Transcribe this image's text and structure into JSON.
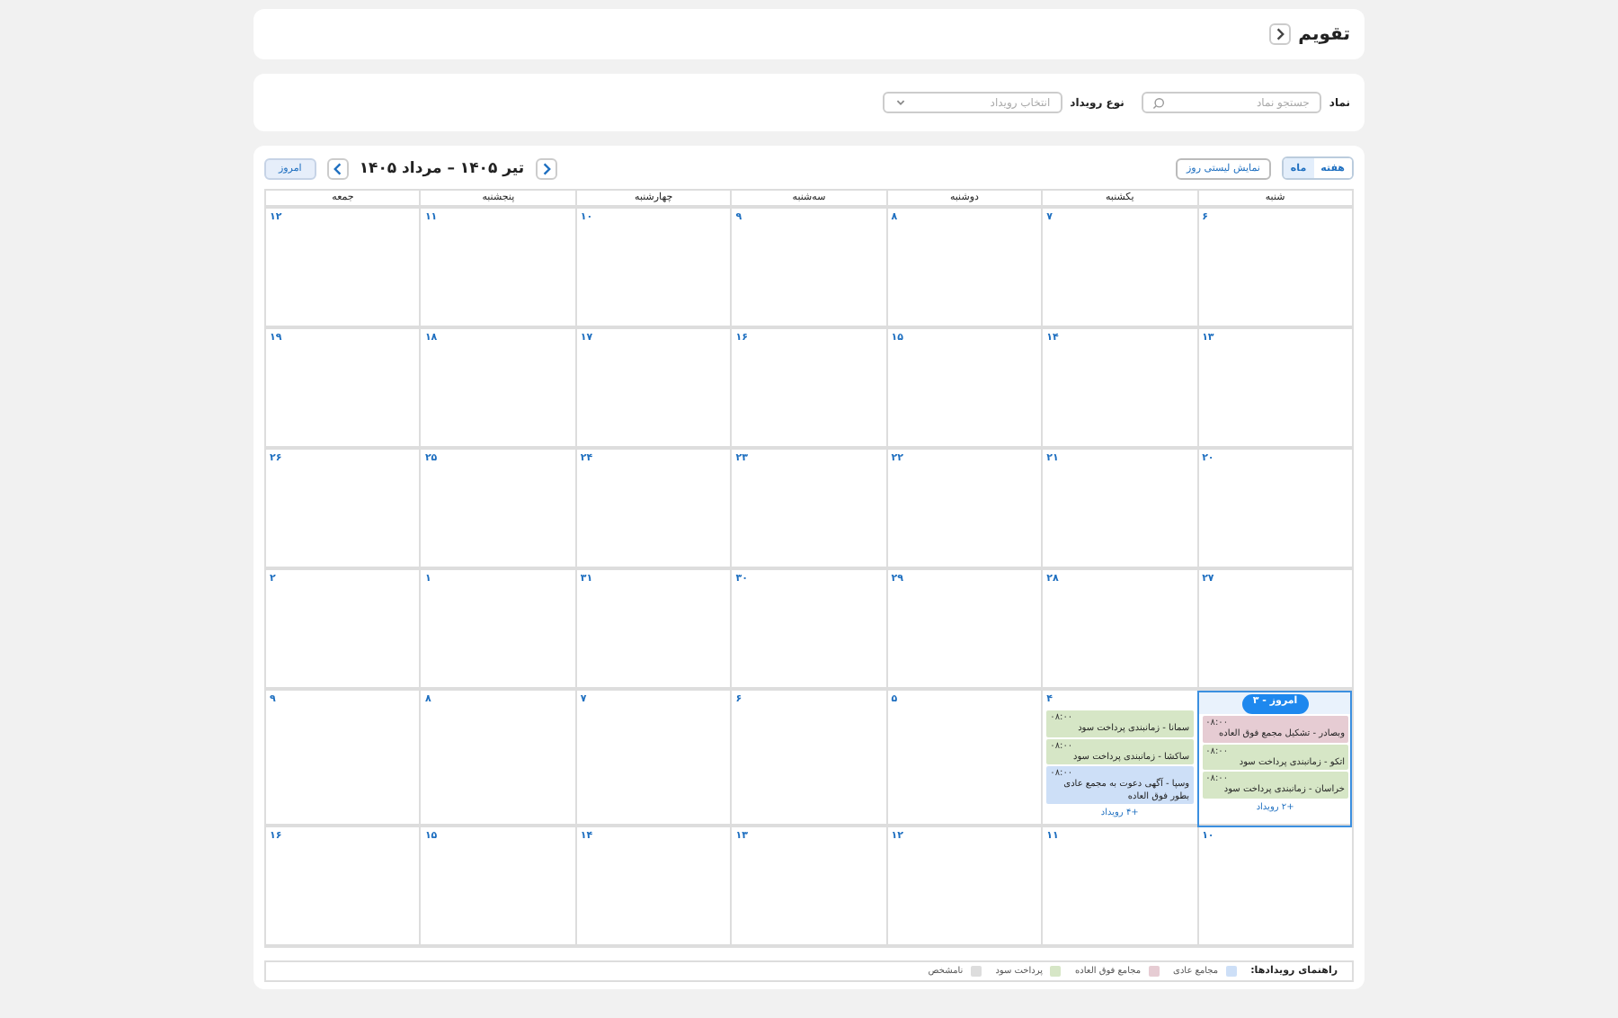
{
  "header": {
    "title": "تقویم"
  },
  "filters": [
    {
      "kind": "search",
      "label": "نماد",
      "placeholder": "جستجو نماد"
    },
    {
      "kind": "select",
      "label": "نوع رویداد",
      "placeholder": "انتخاب رویداد"
    }
  ],
  "view_tabs": [
    {
      "label": "هفته",
      "selected": false
    },
    {
      "label": "ماه",
      "selected": true
    }
  ],
  "list_view_button": "نمایش لیستی روز",
  "range_title": "تیر ۱۴۰۵ – مرداد ۱۴۰۵",
  "today_button": "امروز",
  "weekdays": [
    "شنبه",
    "یکشنبه",
    "دوشنبه",
    "سه‌شنبه",
    "چهارشنبه",
    "پنجشنبه",
    "جمعه"
  ],
  "weeks": [
    [
      {
        "day": "۶",
        "today": false
      },
      {
        "day": "۷",
        "today": false
      },
      {
        "day": "۸",
        "today": false
      },
      {
        "day": "۹",
        "today": false
      },
      {
        "day": "۱۰",
        "today": false
      },
      {
        "day": "۱۱",
        "today": false
      },
      {
        "day": "۱۲",
        "today": false
      }
    ],
    [
      {
        "day": "۱۳",
        "today": false
      },
      {
        "day": "۱۴",
        "today": false
      },
      {
        "day": "۱۵",
        "today": false
      },
      {
        "day": "۱۶",
        "today": false
      },
      {
        "day": "۱۷",
        "today": false
      },
      {
        "day": "۱۸",
        "today": false
      },
      {
        "day": "۱۹",
        "today": false
      }
    ],
    [
      {
        "day": "۲۰",
        "today": false
      },
      {
        "day": "۲۱",
        "today": false
      },
      {
        "day": "۲۲",
        "today": false
      },
      {
        "day": "۲۳",
        "today": false
      },
      {
        "day": "۲۴",
        "today": false
      },
      {
        "day": "۲۵",
        "today": false
      },
      {
        "day": "۲۶",
        "today": false
      }
    ],
    [
      {
        "day": "۲۷",
        "today": false
      },
      {
        "day": "۲۸",
        "today": false
      },
      {
        "day": "۲۹",
        "today": false
      },
      {
        "day": "۳۰",
        "today": false
      },
      {
        "day": "۳۱",
        "today": false
      },
      {
        "day": "۱",
        "today": false
      },
      {
        "day": "۲",
        "today": false
      }
    ],
    [
      {
        "badge": "امروز - ۳",
        "today": true,
        "events": [
          {
            "time": "۰۸:۰۰",
            "title": "وبصادر - تشکیل مجمع فوق العاده",
            "color": "#e6ccd3"
          },
          {
            "time": "۰۸:۰۰",
            "title": "اتکو - زمانبندی پرداخت سود",
            "color": "#d6e6c6"
          },
          {
            "time": "۰۸:۰۰",
            "title": "خراسان - زمانبندی پرداخت سود",
            "color": "#d6e6c6"
          }
        ],
        "more": "+۲ رویداد"
      },
      {
        "day": "۴",
        "today": false,
        "events": [
          {
            "time": "۰۸:۰۰",
            "title": "سمانا - زمانبندی پرداخت سود",
            "color": "#d6e6c6"
          },
          {
            "time": "۰۸:۰۰",
            "title": "ساکشا - زمانبندی پرداخت سود",
            "color": "#d6e6c6"
          },
          {
            "time": "۰۸:۰۰",
            "title": "وسپا - آگهی دعوت به مجمع عادی بطور فوق العاده",
            "color": "#cddff7"
          }
        ],
        "more": "+۴ رویداد"
      },
      {
        "day": "۵",
        "today": false
      },
      {
        "day": "۶",
        "today": false
      },
      {
        "day": "۷",
        "today": false
      },
      {
        "day": "۸",
        "today": false
      },
      {
        "day": "۹",
        "today": false
      }
    ],
    [
      {
        "day": "۱۰",
        "today": false
      },
      {
        "day": "۱۱",
        "today": false
      },
      {
        "day": "۱۲",
        "today": false
      },
      {
        "day": "۱۳",
        "today": false
      },
      {
        "day": "۱۴",
        "today": false
      },
      {
        "day": "۱۵",
        "today": false
      },
      {
        "day": "۱۶",
        "today": false
      }
    ]
  ],
  "legend": {
    "title": "راهنمای رویدادها:",
    "items": [
      {
        "label": "مجامع عادی",
        "color": "#cddff7"
      },
      {
        "label": "مجامع فوق العاده",
        "color": "#e6ccd3"
      },
      {
        "label": "پرداخت سود",
        "color": "#d6e6c6"
      },
      {
        "label": "نامشخص",
        "color": "#dddddd"
      }
    ]
  }
}
